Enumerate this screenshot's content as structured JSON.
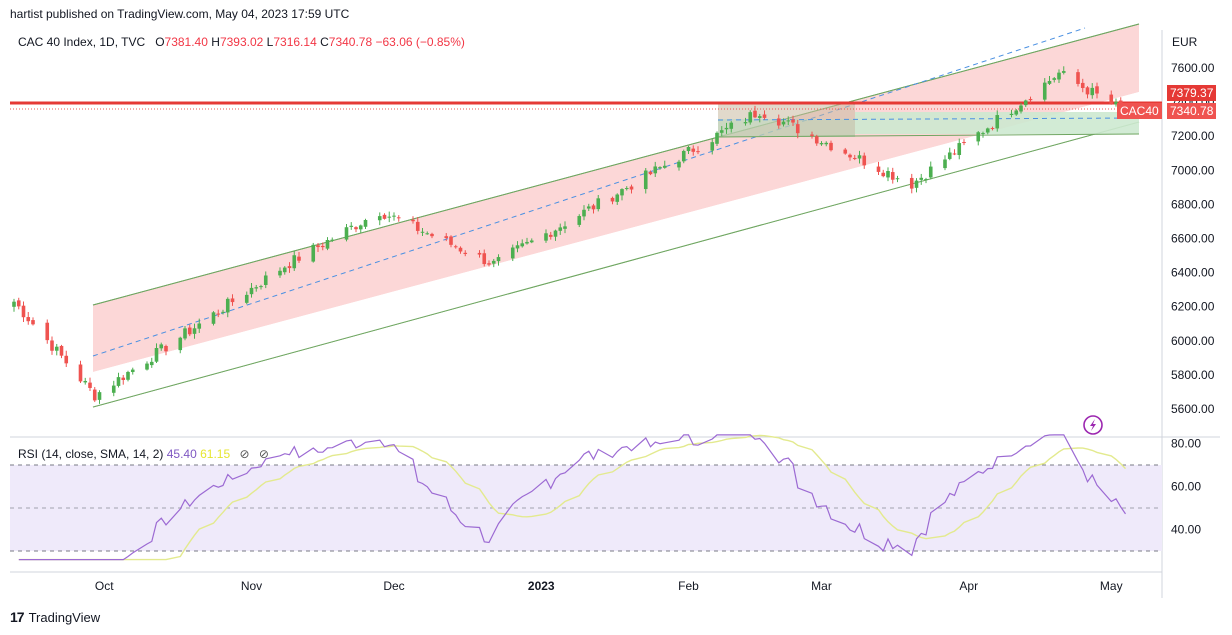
{
  "header": {
    "text": "hartist published on TradingView.com, May 04, 2023 17:59 UTC"
  },
  "footer": {
    "brand": "TradingView",
    "logo_glyph": "17"
  },
  "legend": {
    "symbol": "CAC 40 Index, 1D, TVC",
    "open_label": "O",
    "open": "7381.40",
    "high_label": "H",
    "high": "7393.02",
    "low_label": "L",
    "low": "7316.14",
    "close_label": "C",
    "close": "7340.78",
    "change": "−63.06 (−0.85%)"
  },
  "currency": "EUR",
  "price_tags": {
    "level": "7379.37",
    "symbol": "CAC40",
    "last": "7340.78"
  },
  "rsi_legend": {
    "label": "RSI (14, close, SMA, 14, 2)",
    "rsi": "45.40",
    "sma": "61.15"
  },
  "colors": {
    "up": "#4caf50",
    "down": "#ef5350",
    "channel_fill": "#fbd0d0",
    "channel_line": "#6fa661",
    "mid_line": "#4a90e2",
    "level_line": "#e53935",
    "rsi_line": "#9c6ad3",
    "sma_line": "#e3ea8e",
    "rsi_band": "#efeafa",
    "zone_fill": "#cde9d0"
  },
  "chart_data": [
    {
      "type": "candlestick",
      "price_axis": {
        "ticks": [
          5600,
          5800,
          6000,
          6200,
          6400,
          6600,
          6800,
          7000,
          7200,
          7400,
          7600
        ],
        "range": [
          5480,
          7720
        ]
      },
      "time_axis": {
        "ticks": [
          "Oct",
          "Nov",
          "Dec",
          "2023",
          "Feb",
          "Mar",
          "Apr",
          "May"
        ]
      },
      "key_points": [
        {
          "date": "2022-09-12",
          "close": 6230
        },
        {
          "date": "2022-09-29",
          "close": 5680
        },
        {
          "date": "2022-11-08",
          "close": 6440
        },
        {
          "date": "2022-11-28",
          "close": 6760
        },
        {
          "date": "2022-12-22",
          "close": 6450
        },
        {
          "date": "2023-02-16",
          "close": 7350
        },
        {
          "date": "2023-03-20",
          "close": 6920
        },
        {
          "date": "2023-04-20",
          "close": 7570
        },
        {
          "date": "2023-05-04",
          "close": 7340.78
        }
      ],
      "horizontal_level": 7379.37
    },
    {
      "type": "line",
      "title": "RSI (14, close, SMA, 14, 2)",
      "y_axis": {
        "ticks": [
          40,
          60,
          80
        ],
        "range": [
          25,
          85
        ]
      },
      "bands": [
        30,
        50,
        70
      ],
      "series": [
        {
          "name": "RSI",
          "last": 45.4
        },
        {
          "name": "SMA",
          "last": 61.15
        }
      ]
    }
  ]
}
